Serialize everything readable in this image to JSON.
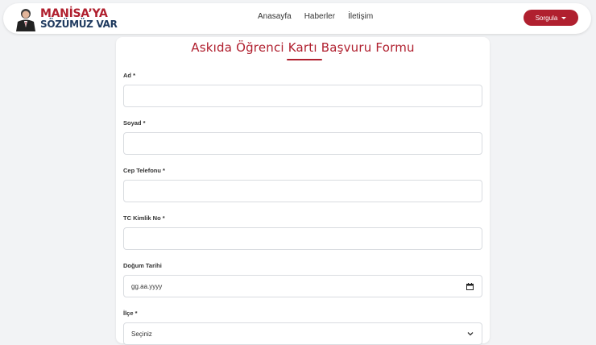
{
  "brand": {
    "line1": "MANİSA’YA",
    "line2": "SÖZÜMÜZ VAR"
  },
  "nav": {
    "items": [
      "Anasayfa",
      "Haberler",
      "İletişim"
    ],
    "sorgula_label": "Sorgula"
  },
  "form": {
    "title": "Askıda Öğrenci Kartı Başvuru Formu",
    "fields": [
      {
        "label": "Ad *"
      },
      {
        "label": "Soyad *"
      },
      {
        "label": "Cep Telefonu *"
      },
      {
        "label": "TC Kimlik No *"
      },
      {
        "label": "Doğum Tarihi",
        "placeholder": "gg.aa.yyyy"
      },
      {
        "label": "İlçe *",
        "value": "Seçiniz"
      }
    ]
  },
  "colors": {
    "accent": "#b0202f",
    "brand_navy": "#1f3a5f",
    "background": "#f2f3f5"
  }
}
